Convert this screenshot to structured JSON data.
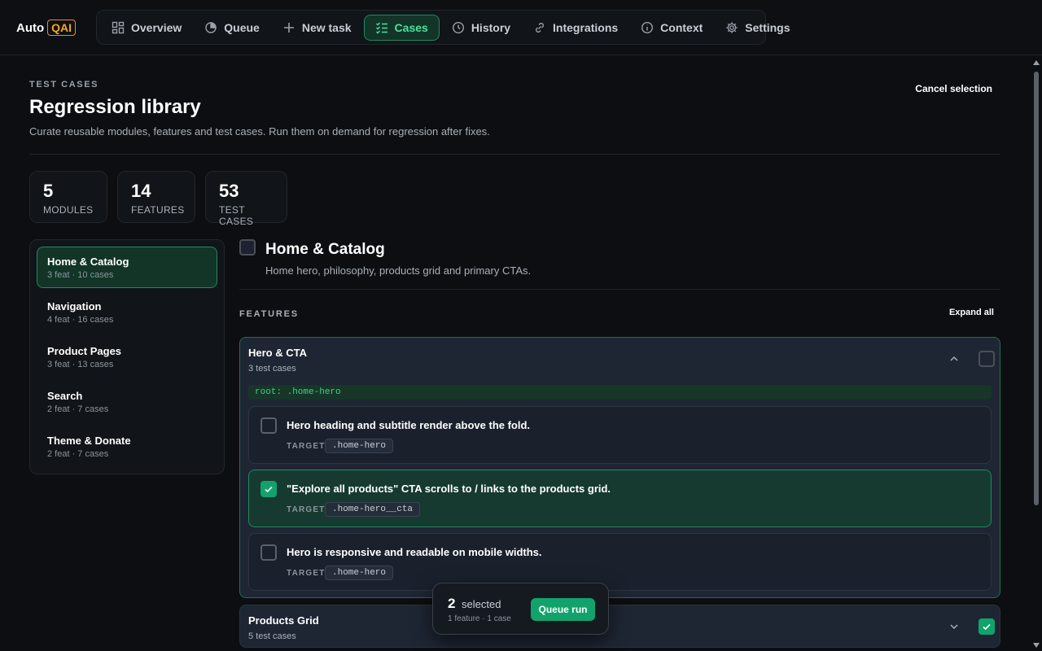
{
  "brand": {
    "auto": "Auto",
    "qai": "QAI"
  },
  "nav": [
    {
      "label": "Overview",
      "icon": "grid-icon"
    },
    {
      "label": "Queue",
      "icon": "queue-icon"
    },
    {
      "label": "New task",
      "icon": "plus-icon"
    },
    {
      "label": "Cases",
      "icon": "checklist-icon",
      "active": true
    },
    {
      "label": "History",
      "icon": "clock-icon"
    },
    {
      "label": "Integrations",
      "icon": "link-icon"
    },
    {
      "label": "Context",
      "icon": "info-icon"
    },
    {
      "label": "Settings",
      "icon": "gear-icon"
    }
  ],
  "header": {
    "eyebrow": "TEST CASES",
    "title": "Regression library",
    "subtitle": "Curate reusable modules, features and test cases. Run them on demand for regression after fixes.",
    "cancel": "Cancel selection"
  },
  "stats": [
    {
      "num": "5",
      "label": "MODULES"
    },
    {
      "num": "14",
      "label": "FEATURES"
    },
    {
      "num": "53",
      "label": "TEST CASES"
    }
  ],
  "modules": [
    {
      "name": "Home & Catalog",
      "meta": "3 feat · 10 cases",
      "active": true
    },
    {
      "name": "Navigation",
      "meta": "4 feat · 16 cases"
    },
    {
      "name": "Product Pages",
      "meta": "3 feat · 13 cases"
    },
    {
      "name": "Search",
      "meta": "2 feat · 7 cases"
    },
    {
      "name": "Theme & Donate",
      "meta": "2 feat · 7 cases"
    }
  ],
  "module": {
    "title": "Home & Catalog",
    "desc": "Home hero, philosophy, products grid and primary CTAs.",
    "features_label": "FEATURES",
    "expand_all": "Expand all"
  },
  "feature1": {
    "name": "Hero & CTA",
    "count": "3 test cases",
    "root": "root: .home-hero",
    "cases": [
      {
        "title": "Hero heading and subtitle render above the fold.",
        "target_label": "TARGET",
        "target": ".home-hero",
        "selected": false
      },
      {
        "title": "\"Explore all products\" CTA scrolls to / links to the products grid.",
        "target_label": "TARGET",
        "target": ".home-hero__cta",
        "selected": true
      },
      {
        "title": "Hero is responsive and readable on mobile widths.",
        "target_label": "TARGET",
        "target": ".home-hero",
        "selected": false
      }
    ]
  },
  "feature2": {
    "name": "Products Grid",
    "count": "5 test cases",
    "checked": true
  },
  "selection": {
    "count": "2",
    "word": "selected",
    "sub": "1 feature · 1 case",
    "queue": "Queue run"
  }
}
